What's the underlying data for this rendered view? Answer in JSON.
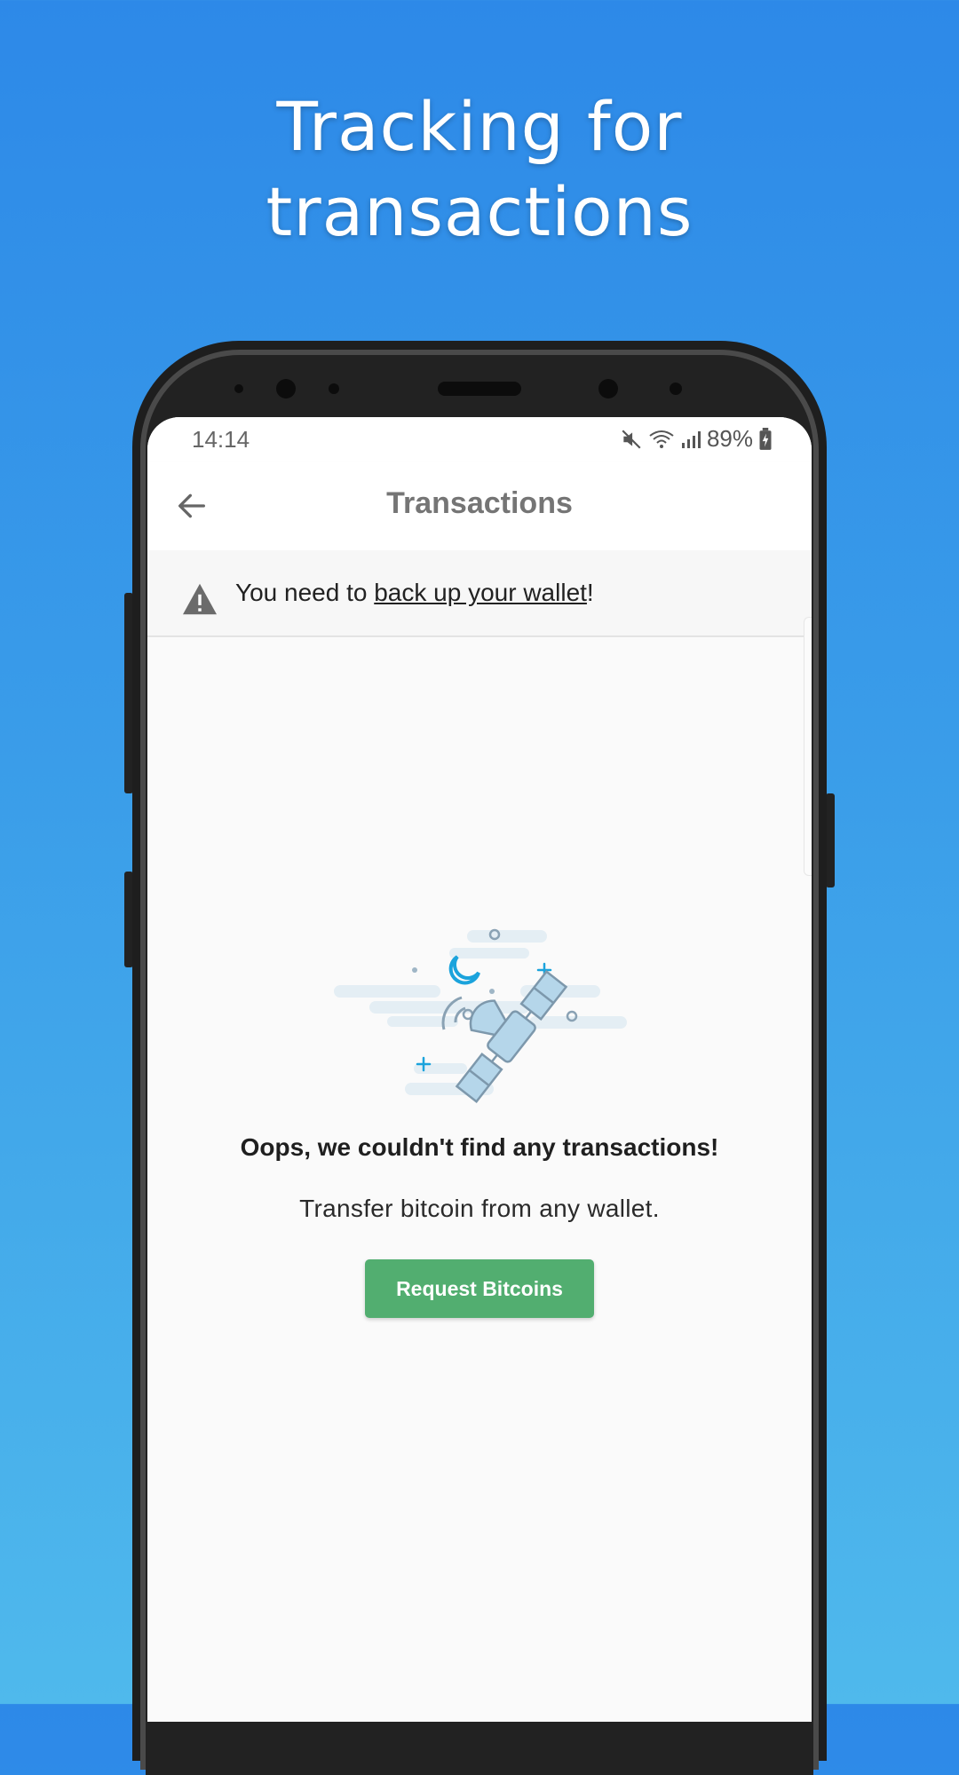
{
  "headline": {
    "line1": "Tracking for",
    "line2": "transactions"
  },
  "status_bar": {
    "time": "14:14",
    "battery": "89%"
  },
  "app_bar": {
    "title": "Transactions"
  },
  "banner": {
    "prefix": "You need to ",
    "link": "back up your wallet",
    "suffix": "!"
  },
  "empty_state": {
    "title": "Oops, we couldn't find any transactions!",
    "subtitle": "Transfer bitcoin from any wallet.",
    "button_label": "Request Bitcoins"
  },
  "colors": {
    "accent_green": "#52ae70",
    "background_blue": "#2d89e8",
    "illustration_blue": "#b5d6ea"
  }
}
